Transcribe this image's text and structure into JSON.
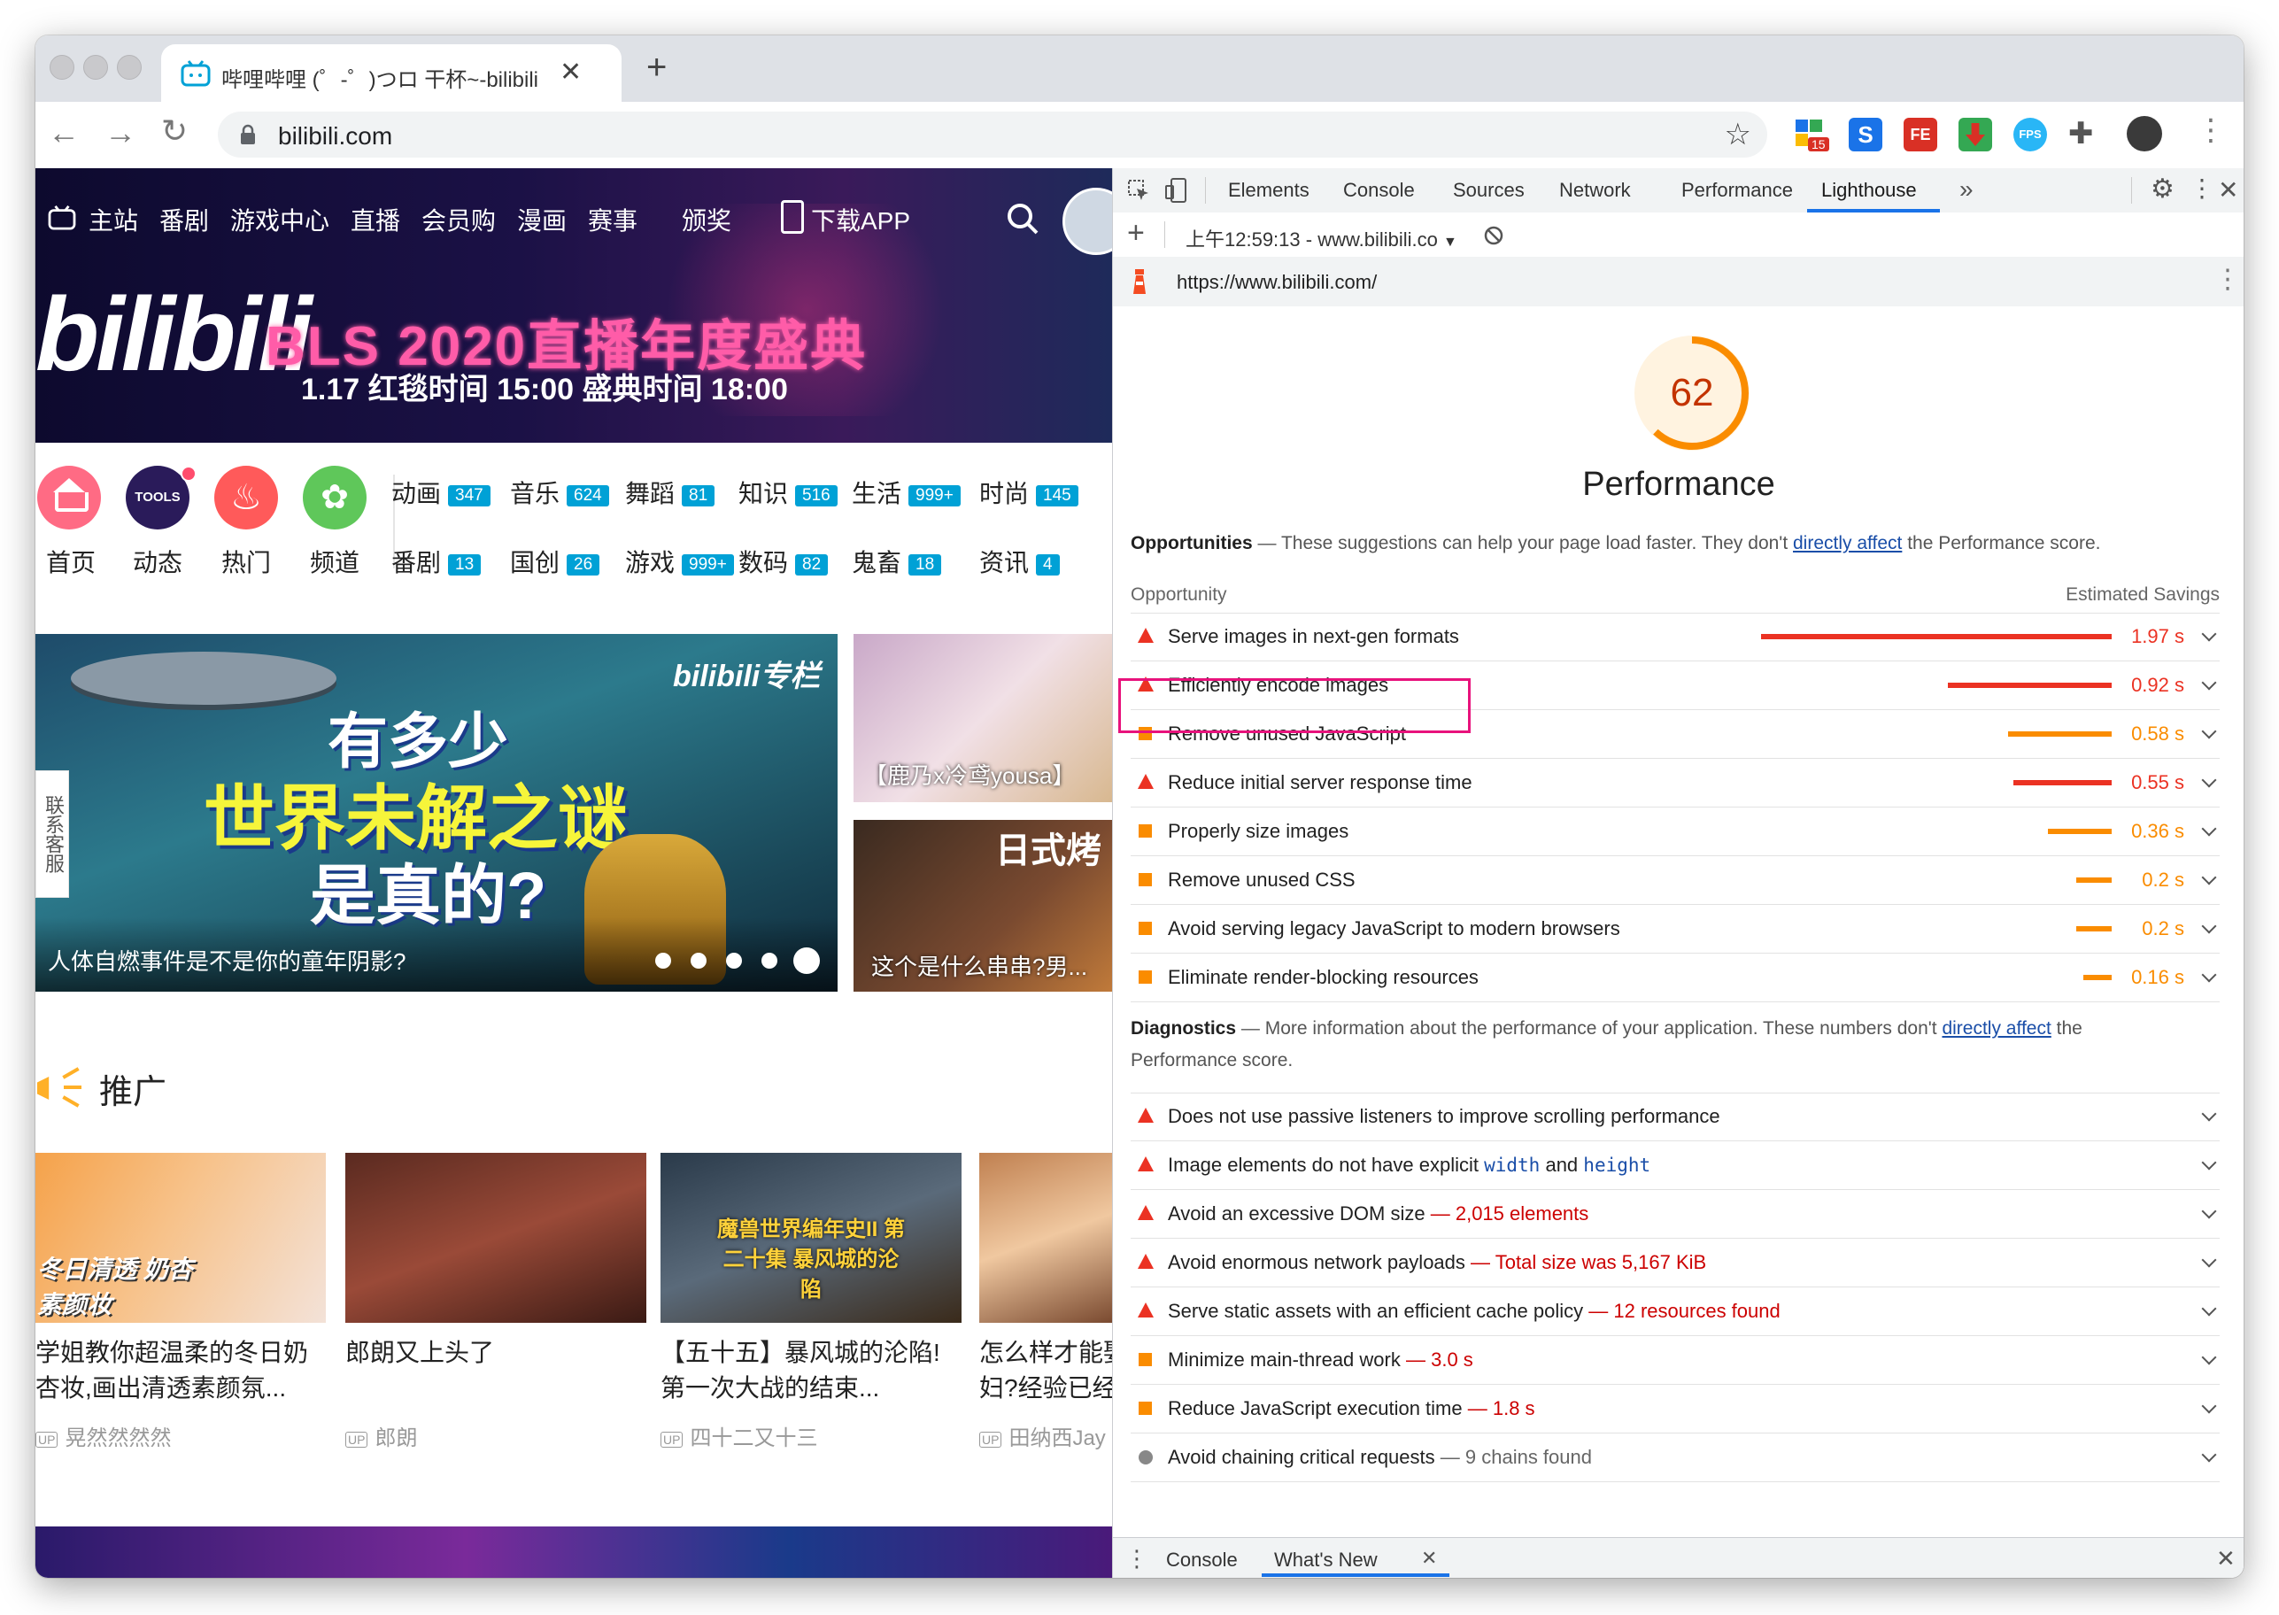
{
  "browser": {
    "tab_title": "哔哩哔哩 (゜-゜)つロ 干杯~-bilibili",
    "url": "bilibili.com",
    "ext_badge": "15"
  },
  "page": {
    "nav": [
      "主站",
      "番剧",
      "游戏中心",
      "直播",
      "会员购",
      "漫画",
      "赛事",
      "颁奖",
      "下载APP"
    ],
    "banner_text": "BLS 2020直播年度盛典",
    "banner_sub": "1.17  红毯时间 15:00  盛典时间 18:00",
    "quick": [
      "首页",
      "动态",
      "热门",
      "频道"
    ],
    "tools_label": "TOOLS",
    "categories_row1": [
      {
        "name": "动画",
        "count": "347"
      },
      {
        "name": "音乐",
        "count": "624"
      },
      {
        "name": "舞蹈",
        "count": "81"
      },
      {
        "name": "知识",
        "count": "516"
      },
      {
        "name": "生活",
        "count": "999+"
      },
      {
        "name": "时尚",
        "count": "145"
      }
    ],
    "categories_row2": [
      {
        "name": "番剧",
        "count": "13"
      },
      {
        "name": "国创",
        "count": "26"
      },
      {
        "name": "游戏",
        "count": "999+"
      },
      {
        "name": "数码",
        "count": "82"
      },
      {
        "name": "鬼畜",
        "count": "18"
      },
      {
        "name": "资讯",
        "count": "4"
      }
    ],
    "carousel_caption": "人体自燃事件是不是你的童年阴影?",
    "carousel_big_1": "有多少",
    "carousel_big_2": "世界未解之谜",
    "carousel_big_3": "是真的?",
    "column_label": "bilibili专栏",
    "side_card_1": "【鹿乃x冷鸢yousa】",
    "side_card_2": "这个是什么串串?男...",
    "side_card_2_tag": "日式烤",
    "contact": "联系客服",
    "promo_heading": "推广",
    "cards": [
      {
        "title": "学姐教你超温柔的冬日奶杏妆,画出清透素颜氛...",
        "up": "晃然然然然",
        "thumb_text": "冬日清透 奶杏素颜妆"
      },
      {
        "title": "郎朗又上头了",
        "up": "郎朗",
        "thumb_text": ""
      },
      {
        "title": "【五十五】暴风城的沦陷!第一次大战的结束...",
        "up": "四十二又十三",
        "thumb_text": "魔兽世界编年史II 第二十集 暴风城的沦陷"
      },
      {
        "title": "怎么样才能娶到中国媳妇?经验已经...",
        "up": "田纳西Jay",
        "thumb_text": ""
      }
    ]
  },
  "devtools": {
    "tabs": [
      "Elements",
      "Console",
      "Sources",
      "Network",
      "Performance",
      "Lighthouse"
    ],
    "active_tab": "Lighthouse",
    "report_select": "上午12:59:13 - www.bilibili.co",
    "report_url": "https://www.bilibili.com/",
    "score": "62",
    "score_label": "Performance",
    "opportunities_heading": "Opportunities",
    "opportunities_desc": "These suggestions can help your page load faster. They don't",
    "link_text": "directly affect",
    "opportunities_desc_tail": "the Performance score.",
    "col_opportunity": "Opportunity",
    "col_savings": "Estimated Savings",
    "opportunities": [
      {
        "title": "Serve images in next-gen formats",
        "value": "1.97 s",
        "seconds": 1.97,
        "severity": "fail"
      },
      {
        "title": "Efficiently encode images",
        "value": "0.92 s",
        "seconds": 0.92,
        "severity": "fail"
      },
      {
        "title": "Remove unused JavaScript",
        "value": "0.58 s",
        "seconds": 0.58,
        "severity": "average"
      },
      {
        "title": "Reduce initial server response time",
        "value": "0.55 s",
        "seconds": 0.55,
        "severity": "fail"
      },
      {
        "title": "Properly size images",
        "value": "0.36 s",
        "seconds": 0.36,
        "severity": "average"
      },
      {
        "title": "Remove unused CSS",
        "value": "0.2 s",
        "seconds": 0.2,
        "severity": "average"
      },
      {
        "title": "Avoid serving legacy JavaScript to modern browsers",
        "value": "0.2 s",
        "seconds": 0.2,
        "severity": "average"
      },
      {
        "title": "Eliminate render-blocking resources",
        "value": "0.16 s",
        "seconds": 0.16,
        "severity": "average"
      }
    ],
    "diagnostics_heading": "Diagnostics",
    "diagnostics_desc": "More information about the performance of your application. These numbers don't",
    "diagnostics_desc_tail_1": "the",
    "diagnostics_desc_tail_2": "Performance score.",
    "diagnostics": [
      {
        "title": "Does not use passive listeners to improve scrolling performance",
        "detail": "",
        "severity": "fail"
      },
      {
        "title": "Image elements do not have explicit",
        "code1": "width",
        "and": "and",
        "code2": "height",
        "detail": "",
        "severity": "fail"
      },
      {
        "title": "Avoid an excessive DOM size",
        "detail": "2,015 elements",
        "severity": "fail"
      },
      {
        "title": "Avoid enormous network payloads",
        "detail": "Total size was 5,167 KiB",
        "severity": "fail"
      },
      {
        "title": "Serve static assets with an efficient cache policy",
        "detail": "12 resources found",
        "severity": "fail"
      },
      {
        "title": "Minimize main-thread work",
        "detail": "3.0 s",
        "severity": "average"
      },
      {
        "title": "Reduce JavaScript execution time",
        "detail": "1.8 s",
        "severity": "average"
      },
      {
        "title": "Avoid chaining critical requests",
        "detail": "9 chains found",
        "severity": "info"
      }
    ],
    "drawer_tabs": [
      "Console",
      "What's New"
    ],
    "colors": {
      "fail": "#eb3223",
      "average": "#fa8c00",
      "info": "#888888",
      "highlight": "#e8127c",
      "accent": "#1a73e8"
    }
  }
}
